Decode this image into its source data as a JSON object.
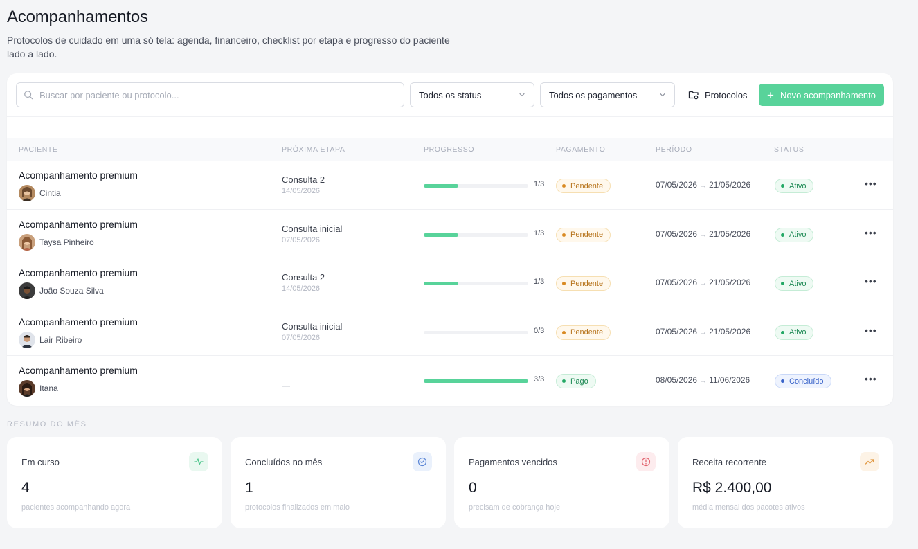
{
  "page": {
    "title": "Acompanhamentos",
    "subtitle": "Protocolos de cuidado em uma só tela: agenda, financeiro, checklist por etapa e progresso do paciente lado a lado."
  },
  "toolbar": {
    "search_placeholder": "Buscar por paciente ou protocolo...",
    "status_filter": "Todos os status",
    "payment_filter": "Todos os pagamentos",
    "protocols_label": "Protocolos",
    "new_label": "Novo acompanhamento",
    "accent": "#58d39a"
  },
  "table": {
    "headers": {
      "paciente": "PACIENTE",
      "proxima_etapa": "PRÓXIMA ETAPA",
      "progresso": "PROGRESSO",
      "pagamento": "PAGAMENTO",
      "periodo": "PERÍODO",
      "status": "STATUS"
    },
    "rows": [
      {
        "protocol": "Acompanhamento premium",
        "patient": "Cintia",
        "step": "Consulta 2",
        "step_date": "14/05/2026",
        "progress_text": "1/3",
        "progress": 0.333,
        "payment": "Pendente",
        "start": "07/05/2026",
        "arrow": "→",
        "end": "21/05/2026",
        "status": "Ativo",
        "more": "•••"
      },
      {
        "protocol": "Acompanhamento premium",
        "patient": "Taysa Pinheiro",
        "step": "Consulta inicial",
        "step_date": "07/05/2026",
        "progress_text": "1/3",
        "progress": 0.333,
        "payment": "Pendente",
        "start": "07/05/2026",
        "arrow": "→",
        "end": "21/05/2026",
        "status": "Ativo",
        "more": "•••"
      },
      {
        "protocol": "Acompanhamento premium",
        "patient": "João Souza Silva",
        "step": "Consulta 2",
        "step_date": "14/05/2026",
        "progress_text": "1/3",
        "progress": 0.333,
        "payment": "Pendente",
        "start": "07/05/2026",
        "arrow": "→",
        "end": "21/05/2026",
        "status": "Ativo",
        "more": "•••"
      },
      {
        "protocol": "Acompanhamento premium",
        "patient": "Lair Ribeiro",
        "step": "Consulta inicial",
        "step_date": "07/05/2026",
        "progress_text": "0/3",
        "progress": 0,
        "payment": "Pendente",
        "start": "07/05/2026",
        "arrow": "→",
        "end": "21/05/2026",
        "status": "Ativo",
        "more": "•••"
      },
      {
        "protocol": "Acompanhamento premium",
        "patient": "Itana",
        "step_empty": "—",
        "progress_text": "3/3",
        "progress": 1,
        "payment": "Pago",
        "start": "08/05/2026",
        "arrow": "→",
        "end": "11/06/2026",
        "status": "Concluído",
        "more": "•••"
      }
    ]
  },
  "summary": {
    "label": "RESUMO DO MÊS",
    "cards": [
      {
        "title": "Em curso",
        "value": "4",
        "sub": "pacientes acompanhando agora",
        "icon": "activity-icon",
        "icon_bg": "#e9f8f0",
        "icon_color": "#4cc58b"
      },
      {
        "title": "Concluídos no mês",
        "value": "1",
        "sub": "protocolos finalizados em maio",
        "icon": "check-circle-icon",
        "icon_bg": "#eaf1fc",
        "icon_color": "#5b86d6"
      },
      {
        "title": "Pagamentos vencidos",
        "value": "0",
        "sub": "precisam de cobrança hoje",
        "icon": "alert-circle-icon",
        "icon_bg": "#fdecee",
        "icon_color": "#e2646f"
      },
      {
        "title": "Receita recorrente",
        "value": "R$ 2.400,00",
        "sub": "média mensal dos pacotes ativos",
        "icon": "trending-up-icon",
        "icon_bg": "#fdf3e6",
        "icon_color": "#e29a45"
      }
    ]
  }
}
